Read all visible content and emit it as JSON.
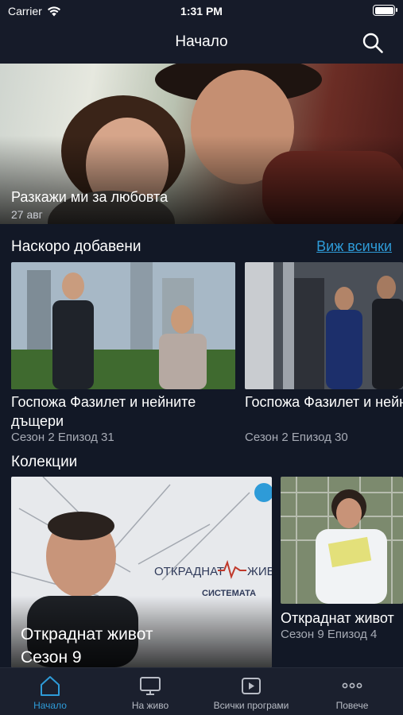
{
  "status_bar": {
    "carrier": "Carrier",
    "time": "1:31 PM"
  },
  "nav": {
    "title": "Начало"
  },
  "hero": {
    "title": "Разкажи ми за любовта",
    "date": "27 авг"
  },
  "recent": {
    "title": "Наскоро добавени",
    "see_all": "Виж всички",
    "items": [
      {
        "title": "Госпожа Фазилет и нейните дъщери",
        "subtitle": "Сезон 2 Епизод 31"
      },
      {
        "title": "Госпожа Фазилет и нейните дъщери",
        "subtitle": "Сезон 2 Епизод 30"
      }
    ]
  },
  "collections": {
    "title": "Колекции",
    "items": [
      {
        "title": "Откраднат живот Сезон 9",
        "logo_line1": "ОТКРАДНАТ",
        "logo_line2": "ЖИВ",
        "logo_sub": "СИСТЕМАТА"
      },
      {
        "title": "Откраднат живот",
        "subtitle": "Сезон 9 Епизод 4"
      }
    ]
  },
  "tab_bar": {
    "tabs": [
      {
        "label": "Начало",
        "icon": "home-icon",
        "active": true
      },
      {
        "label": "На живо",
        "icon": "tv-icon",
        "active": false
      },
      {
        "label": "Всички програми",
        "icon": "play-folder-icon",
        "active": false
      },
      {
        "label": "Повече",
        "icon": "more-icon",
        "active": false
      }
    ]
  },
  "colors": {
    "background": "#121826",
    "accent": "#2e9bd8",
    "bar": "#161b29"
  }
}
